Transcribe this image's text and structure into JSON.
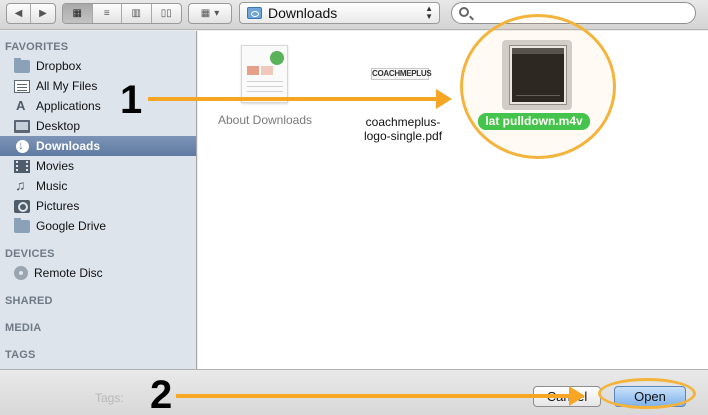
{
  "toolbar": {
    "back_icon": "back-arrow-icon",
    "forward_icon": "forward-arrow-icon",
    "view_modes": [
      "icon-view",
      "list-view",
      "column-view",
      "cover-flow-view"
    ],
    "location": "Downloads",
    "search_placeholder": ""
  },
  "sidebar": {
    "favorites_header": "FAVORITES",
    "favorites": [
      {
        "label": "Dropbox",
        "icon": "folder-icon"
      },
      {
        "label": "All My Files",
        "icon": "all-files-icon"
      },
      {
        "label": "Applications",
        "icon": "applications-icon"
      },
      {
        "label": "Desktop",
        "icon": "desktop-icon"
      },
      {
        "label": "Downloads",
        "icon": "downloads-icon",
        "selected": true
      },
      {
        "label": "Movies",
        "icon": "movies-icon"
      },
      {
        "label": "Music",
        "icon": "music-icon"
      },
      {
        "label": "Pictures",
        "icon": "pictures-icon"
      },
      {
        "label": "Google Drive",
        "icon": "folder-icon"
      }
    ],
    "devices_header": "DEVICES",
    "devices": [
      {
        "label": "Remote Disc",
        "icon": "disc-icon"
      }
    ],
    "shared_header": "SHARED",
    "media_header": "MEDIA",
    "tags_header": "TAGS"
  },
  "files": [
    {
      "name": "About Downloads",
      "selected": false
    },
    {
      "name_line1": "coachmeplus-",
      "name_line2": "logo-single.pdf",
      "thumb_text": "COACHMEPLUS",
      "selected": false
    },
    {
      "name": "lat pulldown.m4v",
      "selected": true
    }
  ],
  "annotations": {
    "step1": "1",
    "step2": "2",
    "accent_color": "#f6a623"
  },
  "bottom": {
    "tags_label": "Tags:",
    "cancel_label": "Cancel",
    "open_label": "Open"
  }
}
